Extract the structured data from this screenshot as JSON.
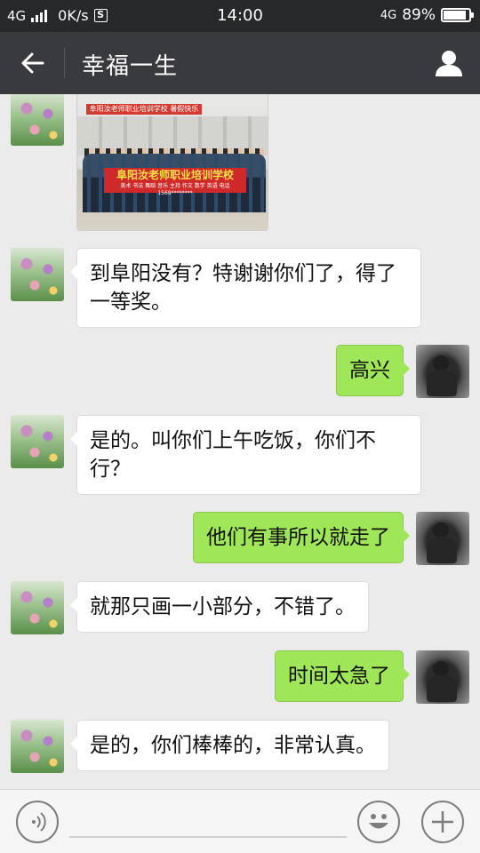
{
  "status_bar": {
    "network": "4G",
    "speed": "0K/s",
    "s_icon": "S",
    "time": "14:00",
    "network_right": "4G",
    "battery": "89%",
    "battery_level": 0.89
  },
  "header": {
    "title": "幸福一生",
    "back_icon": "arrow-left-icon",
    "profile_icon": "person-icon"
  },
  "photo": {
    "banner_small": "阜阳汝老师职业培训学校 暑假快乐",
    "banner_main": "阜阳汝老师职业培训学校",
    "banner_sub": "美术 书法 舞蹈 音乐 主持 作文 数学 英语 电话 1569********"
  },
  "messages": [
    {
      "side": "left",
      "text": "到阜阳没有？特谢谢你们了，得了一等奖。"
    },
    {
      "side": "right",
      "text": "高兴"
    },
    {
      "side": "left",
      "text": "是的。叫你们上午吃饭，你们不行？"
    },
    {
      "side": "right",
      "text": "他们有事所以就走了"
    },
    {
      "side": "left",
      "text": "就那只画一小部分，不错了。"
    },
    {
      "side": "right",
      "text": "时间太急了"
    },
    {
      "side": "left",
      "text": "是的，你们棒棒的，非常认真。"
    }
  ],
  "input_bar": {
    "voice_icon": "voice-icon",
    "emoji_icon": "emoji-icon",
    "plus_icon": "plus-icon"
  }
}
